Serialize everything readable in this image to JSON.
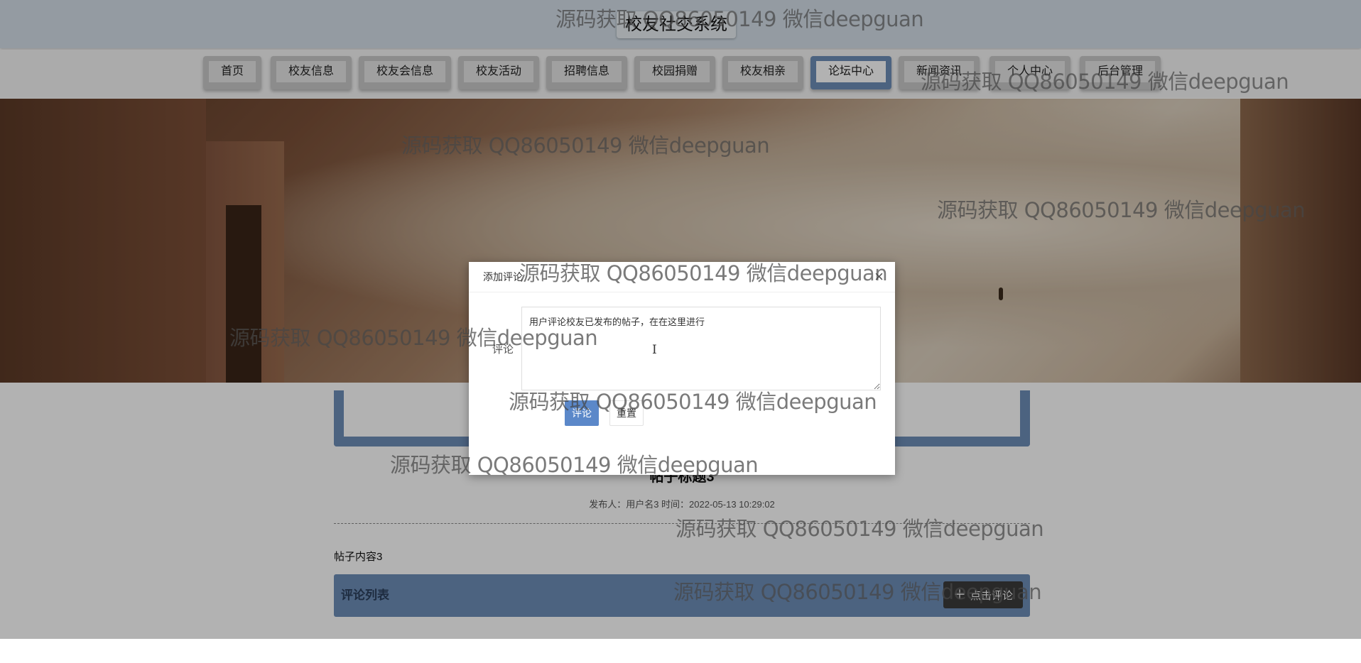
{
  "app": {
    "title": "校友社交系统"
  },
  "nav": {
    "items": [
      {
        "label": "首页"
      },
      {
        "label": "校友信息"
      },
      {
        "label": "校友会信息"
      },
      {
        "label": "校友活动"
      },
      {
        "label": "招聘信息"
      },
      {
        "label": "校园捐赠"
      },
      {
        "label": "校友相亲"
      },
      {
        "label": "论坛中心",
        "active": true
      },
      {
        "label": "新闻资讯"
      },
      {
        "label": "个人中心"
      },
      {
        "label": "后台管理"
      }
    ]
  },
  "post": {
    "title": "帖子标题3",
    "meta": "发布人：用户名3 时间：2022-05-13 10:29:02",
    "content": "帖子内容3"
  },
  "comments": {
    "section_title": "评论列表",
    "add_button": "点击评论",
    "add_icon": "plus-icon"
  },
  "modal": {
    "title": "添加评论",
    "close_icon": "close-icon",
    "field_label": "评论",
    "textarea_value": "用户评论校友已发布的帖子，在在这里进行",
    "submit_label": "评论",
    "reset_label": "重置"
  },
  "watermark": {
    "text": "源码获取 QQ86050149 微信deepguan"
  },
  "colors": {
    "header_bg": "#d4dfe9",
    "accent": "#6d8eb8",
    "primary_button": "#5b88c9",
    "dark_button": "#3b3b3b"
  }
}
